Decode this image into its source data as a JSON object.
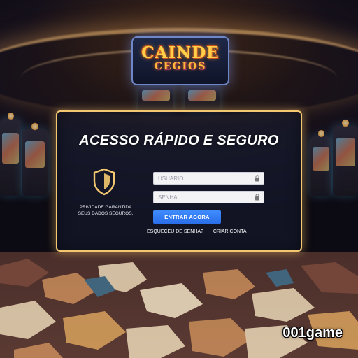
{
  "sign": {
    "line1": "CAINDE",
    "line2": "CEGIOS"
  },
  "login": {
    "title": "ACESSO RÁPIDO E SEGURO",
    "privacy_line1": "PRIVIDADE GARANTIDA",
    "privacy_line2": "SEUS DADOS SEGUROS.",
    "username_placeholder": "USUÁRIO",
    "password_placeholder": "SENHA",
    "enter_label": "ENTRAR AGORA",
    "forgot_label": "ESQUECEU DE SENHA?",
    "create_label": "CRIAR CONTA"
  },
  "watermark": "001game",
  "icons": {
    "shield": "shield-icon",
    "lock": "lock-icon"
  },
  "colors": {
    "panel_border": "#f3c870",
    "button": "#2f7cf6",
    "sign_text": "#ffcf4a"
  }
}
